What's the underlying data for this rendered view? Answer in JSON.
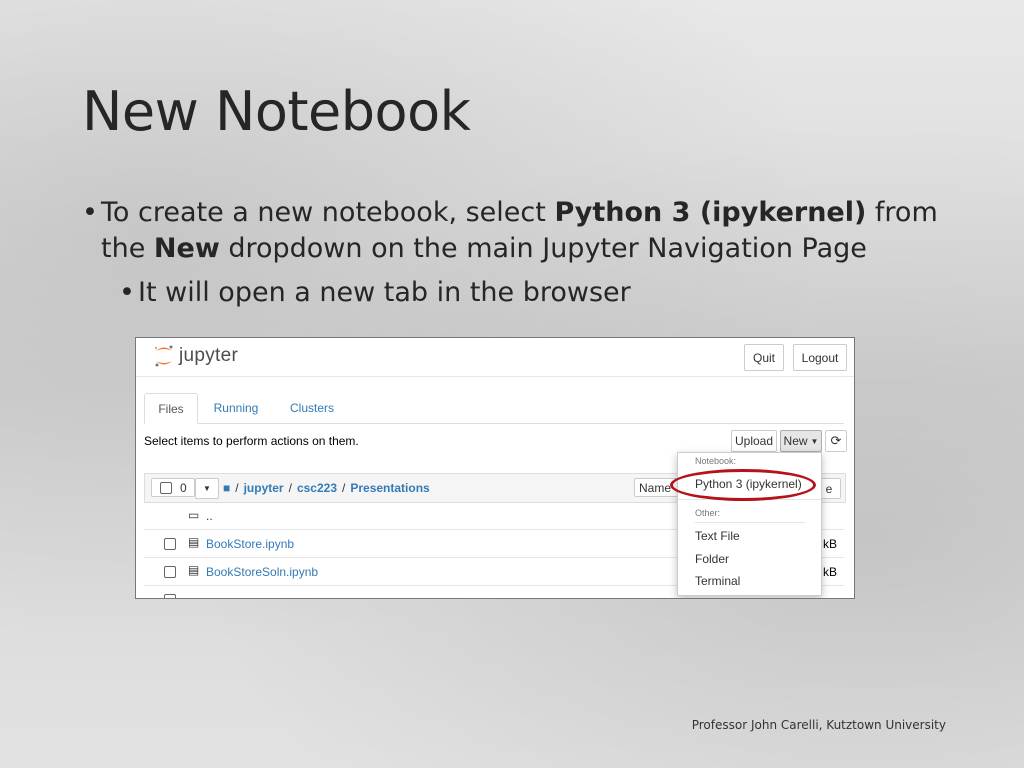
{
  "slide": {
    "title": "New Notebook",
    "bullet1": {
      "part1": "To create a new notebook, select ",
      "bold1": "Python 3 (ipykernel)",
      "part2": " from the ",
      "bold2": "New",
      "part3": " dropdown on the main Jupyter Navigation Page"
    },
    "bullet2": "It will open a new tab in the browser",
    "footer": "Professor John Carelli,  Kutztown University"
  },
  "jupyter": {
    "logo_text": "jupyter",
    "quit_label": "Quit",
    "logout_label": "Logout",
    "tabs": [
      {
        "label": "Files"
      },
      {
        "label": "Running"
      },
      {
        "label": "Clusters"
      }
    ],
    "toolbar_text": "Select items to perform actions on them.",
    "upload_label": "Upload",
    "new_label": "New",
    "select_count": "0",
    "breadcrumb": [
      "jupyter",
      "csc223",
      "Presentations"
    ],
    "sort_label": "Name",
    "parent_dir": "..",
    "files": [
      {
        "name": "BookStore.ipynb",
        "size": "kB"
      },
      {
        "name": "BookStoreSoln.ipynb",
        "size": "kB"
      }
    ],
    "dropdown": {
      "notebook_header": "Notebook:",
      "python3": "Python 3 (ipykernel)",
      "other_header": "Other:",
      "text_file": "Text File",
      "folder": "Folder",
      "terminal": "Terminal"
    },
    "partial_last_col": "e"
  },
  "colors": {
    "accent_link": "#337ab7",
    "highlight_ring": "#b5121b",
    "jupyter_orange": "#f37726"
  }
}
